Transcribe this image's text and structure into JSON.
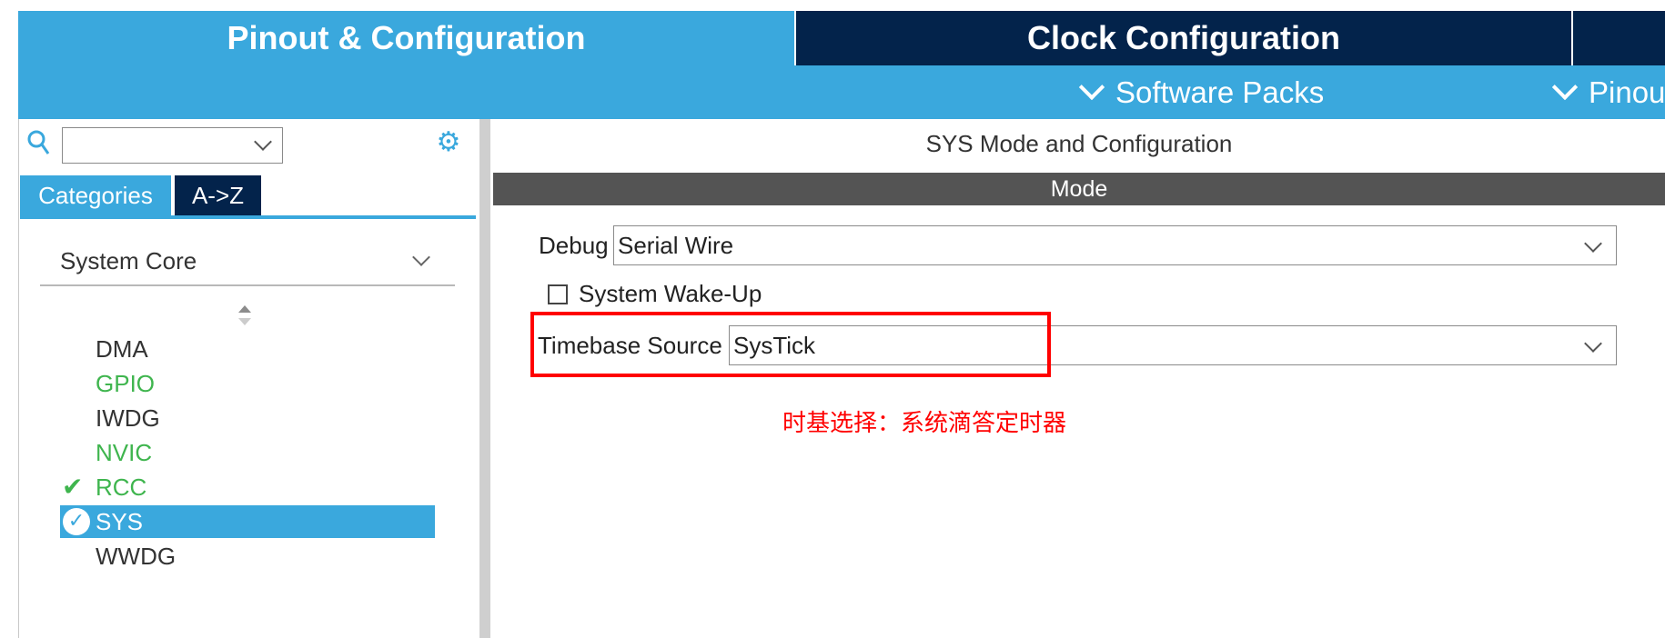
{
  "top_tabs": {
    "pinout": "Pinout & Configuration",
    "clock": "Clock Configuration"
  },
  "sub_menu": {
    "software_packs": "Software Packs",
    "pinout": "Pinou"
  },
  "left": {
    "tabs": {
      "categories": "Categories",
      "az": "A->Z"
    },
    "group": "System Core",
    "items": [
      {
        "label": "DMA",
        "status": "normal"
      },
      {
        "label": "GPIO",
        "status": "green"
      },
      {
        "label": "IWDG",
        "status": "normal"
      },
      {
        "label": "NVIC",
        "status": "green"
      },
      {
        "label": "RCC",
        "status": "check"
      },
      {
        "label": "SYS",
        "status": "selected"
      },
      {
        "label": "WWDG",
        "status": "normal"
      }
    ],
    "search_value": "",
    "icons": {
      "search": "search-icon",
      "gear": "gear-icon",
      "sort": "sort-icon",
      "checkmark": "check-icon"
    }
  },
  "right": {
    "title": "SYS Mode and Configuration",
    "mode_header": "Mode",
    "debug_label": "Debug",
    "debug_value": "Serial Wire",
    "wake_label": "System Wake-Up",
    "wake_checked": false,
    "timebase_label": "Timebase Source",
    "timebase_value": "SysTick",
    "annotation": "时基选择：系统滴答定时器"
  },
  "colors": {
    "accent": "#3aa8dd",
    "dark": "#03234b",
    "highlight": "#ff0000",
    "ok_green": "#3fb54e",
    "mode_bar": "#545454"
  }
}
